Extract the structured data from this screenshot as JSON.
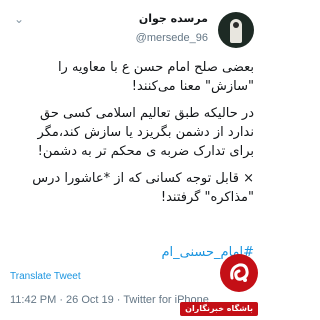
{
  "tweet": {
    "author_name": "مرسده جوان",
    "handle": "@mersede_96",
    "paragraphs": [
      "بعضی صلح امام حسن ع با معاویه را\n\"سازش\" معنا می‌کنند!",
      "در حالیکه طبق تعالیم اسلامی کسی حق\nندارد از دشمن بگریزد یا سازش کند،مگر\nبرای تدارک ضربه ی محکم تر به دشمن!",
      "× قابل توجه کسانی که از *عاشورا درس\n\"مذاکره\" گرفتند!"
    ],
    "hashtag": "#امام_حسنی_ام",
    "translate_label": "Translate Tweet",
    "meta": "11:42 PM · 26 Oct 19 · Twitter for iPhone"
  },
  "watermark": {
    "text": "باشگاه خبرنگاران"
  },
  "colors": {
    "link": "#1b95e0",
    "secondary_text": "#657786",
    "watermark_red": "#c40f16"
  },
  "icons": {
    "more": "chevron-down-icon"
  }
}
